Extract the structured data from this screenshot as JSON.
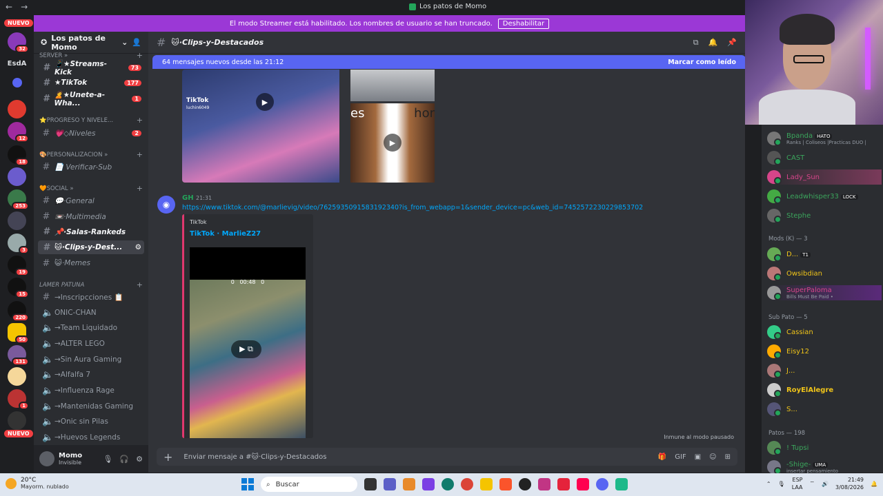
{
  "window": {
    "title": "Los patos de Momo"
  },
  "banner": {
    "text": "El modo Streamer está habilitado. Los nombres de usuario se han truncado.",
    "button": "Deshabilitar"
  },
  "guilds": {
    "new_top": "NUEVO",
    "new_bottom": "NUEVO",
    "esda": "EsdA",
    "badges": [
      "32",
      "12",
      "18",
      "253",
      "3",
      "19",
      "15",
      "220",
      "50",
      "131",
      "1"
    ]
  },
  "server": {
    "name": "Los patos de Momo"
  },
  "categories": {
    "server": "SERVER »",
    "progreso": "⭐PROGRESO Y NIVELE...",
    "personalizacion": "🎨PERSONALIZACION »",
    "social": "🧡SOCIAL »",
    "lamer": "LAMER PATUNA"
  },
  "channels": [
    {
      "name": "📱★Streams-Kick",
      "count": "73"
    },
    {
      "name": "★TikTok",
      "count": "177"
    },
    {
      "name": "🙎★Unete-a-Wha...",
      "count": "1"
    },
    {
      "name": "💗◇Niveles",
      "count": "2"
    },
    {
      "name": "📄 Verificar-Sub",
      "count": ""
    },
    {
      "name": "💬·General",
      "count": ""
    },
    {
      "name": "📼·Multimedia",
      "count": ""
    },
    {
      "name": "📌·Salas-Rankeds",
      "count": ""
    },
    {
      "name": "🐱·Clips-y-Dest...",
      "count": ""
    },
    {
      "name": "😺·Memes",
      "count": ""
    },
    {
      "name": "→Inscripcciones 📋",
      "count": ""
    },
    {
      "name": "ONIC-CHAN",
      "count": ""
    },
    {
      "name": "→Team Liquidado",
      "count": ""
    },
    {
      "name": "→ALTER LEGO",
      "count": ""
    },
    {
      "name": "→Sin Aura Gaming",
      "count": ""
    },
    {
      "name": "→Alfalfa 7",
      "count": ""
    },
    {
      "name": "→Influenza Rage",
      "count": ""
    },
    {
      "name": "→Mantenidas Gaming",
      "count": ""
    },
    {
      "name": "→Onic sin Pilas",
      "count": ""
    },
    {
      "name": "→Huevos Legends",
      "count": ""
    }
  ],
  "user": {
    "name": "Momo",
    "status": "Invisible"
  },
  "channel_header": {
    "name": "🐱·Clips-y-Destacados"
  },
  "new_messages": {
    "text": "64 mensajes nuevos desde las 21:12",
    "action": "Marcar como leído"
  },
  "media": {
    "tiktok_brand": "TikTok",
    "handle": "luchin6049",
    "overlay_left": "es",
    "overlay_right": "hor"
  },
  "message": {
    "author": "GH",
    "time": "21:31",
    "link": "https://www.tiktok.com/@marlievig/video/7625935091583192340?is_from_webapp=1&sender_device=pc&web_id=7452572230229853702",
    "embed_provider": "TikTok",
    "embed_title": "TikTok · MarlieZ27",
    "video_time": "00:48",
    "video_left": "0",
    "video_right": "0"
  },
  "immune": "Inmune al modo pausado",
  "composer": {
    "placeholder": "Enviar mensaje a #🐱·Clips-y-Destacados"
  },
  "members": {
    "top": [
      {
        "name": "Bpanda",
        "tag": "HATO",
        "sub": "Ranks | Coliseos |Practicas DUO |",
        "color": "#3ba55c"
      },
      {
        "name": "CAST",
        "tag": "",
        "sub": "",
        "color": "#3ba55c"
      },
      {
        "name": "Lady_Sun",
        "tag": "",
        "sub": "",
        "color": "#d6458a"
      },
      {
        "name": "Leadwhisper33",
        "tag": "LOCK",
        "sub": "",
        "color": "#3ba55c"
      },
      {
        "name": "Stephe",
        "tag": "",
        "sub": "",
        "color": "#3ba55c"
      }
    ],
    "mods_label": "Mods (K) — 3",
    "mods": [
      {
        "name": "D...",
        "tag": "T1",
        "sub": "",
        "color": "#f0c419"
      },
      {
        "name": "Owsibdian",
        "tag": "",
        "sub": "",
        "color": "#f0c419"
      },
      {
        "name": "SuperPaloma",
        "tag": "",
        "sub": "Bills Must Be Paid •",
        "color": "#d6458a"
      }
    ],
    "sub_label": "Sub Pato — 5",
    "subs": [
      {
        "name": "Cassian",
        "tag": "",
        "sub": "",
        "color": "#f0c419"
      },
      {
        "name": "Eisy12",
        "tag": "",
        "sub": "",
        "color": "#f0c419"
      },
      {
        "name": "J...",
        "tag": "",
        "sub": "",
        "color": "#f0c419"
      },
      {
        "name": "RoyElAlegre",
        "tag": "",
        "sub": "",
        "color": "#f0c419"
      },
      {
        "name": "S...",
        "tag": "",
        "sub": "",
        "color": "#f0c419"
      }
    ],
    "patos_label": "Patos — 198",
    "patos": [
      {
        "name": "! Tupsi",
        "tag": "",
        "sub": "",
        "color": "#3ba55c"
      },
      {
        "name": "-Shige-",
        "tag": "UMA",
        "sub": "insertar pensamiento",
        "color": "#3ba55c"
      }
    ]
  },
  "taskbar": {
    "temp": "20°C",
    "weather": "Mayorm. nublado",
    "search": "Buscar",
    "lang": "ESP",
    "lang2": "LAA",
    "time": "21:49",
    "date": "3/08/2026"
  }
}
